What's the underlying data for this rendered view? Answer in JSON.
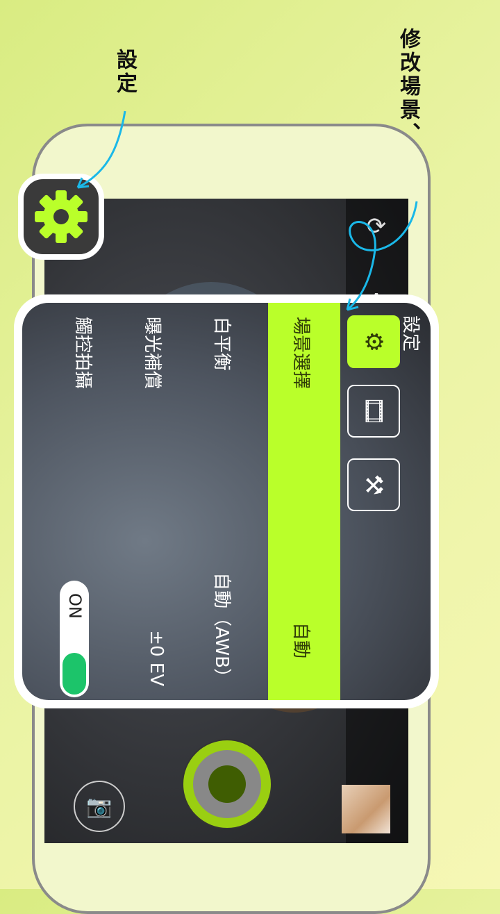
{
  "annotations": {
    "settings_note": "設定",
    "scene_note": "修改場景、白平衡、曝光等相機設定"
  },
  "camera": {
    "top_icons": [
      "rotate-camera-icon",
      "flash-auto-icon",
      "auto-mode-icon",
      "battery-icon"
    ],
    "tabs_behind": [
      "觸",
      "曝",
      "白",
      "場",
      "設"
    ]
  },
  "panel": {
    "title": "設定",
    "tabs": [
      {
        "name": "scene-settings-tab",
        "icon": "camera-gear-icon",
        "selected": true
      },
      {
        "name": "video-tab",
        "icon": "film-icon",
        "selected": false
      },
      {
        "name": "tools-tab",
        "icon": "tools-icon",
        "selected": false
      }
    ],
    "rows": [
      {
        "label": "場景選擇",
        "value": "自動",
        "selected": true
      },
      {
        "label": "白平衡",
        "value": "自動（AWB）",
        "selected": false
      },
      {
        "label": "曝光補償",
        "value": "±0 EV",
        "selected": false
      },
      {
        "label": "觸控拍攝",
        "value": "ON",
        "selected": false
      }
    ]
  },
  "colors": {
    "accent": "#baff2a",
    "toggle_on": "#1cc46a",
    "annotation_arrow": "#1ab8e8"
  }
}
